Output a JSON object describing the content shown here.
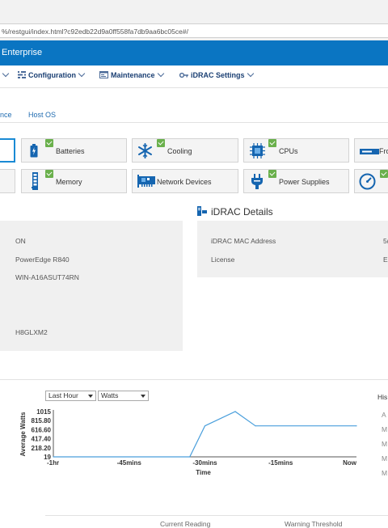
{
  "browser": {
    "url": "%/restgui/index.html?c92edb22d9a0ff558fa7db9aa6bc05ce#/"
  },
  "header": {
    "title": "Enterprise"
  },
  "nav": {
    "configuration": "Configuration",
    "maintenance": "Maintenance",
    "idrac_settings": "iDRAC Settings"
  },
  "subtabs": {
    "first": "nce",
    "second": "Host OS"
  },
  "tiles": [
    {
      "label": "",
      "icon": "blank"
    },
    {
      "label": "Batteries",
      "icon": "battery-icon"
    },
    {
      "label": "Cooling",
      "icon": "snowflake-icon"
    },
    {
      "label": "CPUs",
      "icon": "cpu-icon"
    },
    {
      "label": "Fro",
      "icon": "front-panel-icon"
    },
    {
      "label": "",
      "icon": "blank"
    },
    {
      "label": "Memory",
      "icon": "memory-icon"
    },
    {
      "label": "Network Devices",
      "icon": "network-card-icon"
    },
    {
      "label": "Power Supplies",
      "icon": "power-plug-icon"
    },
    {
      "label": "",
      "icon": "gauge-icon"
    }
  ],
  "system_info": {
    "values": [
      "ON",
      "PowerEdge R840",
      "WIN-A16ASUT74RN",
      "H8GLXM2"
    ]
  },
  "idrac_details": {
    "title": "iDRAC Details",
    "rows": [
      {
        "label": "iDRAC MAC Address",
        "value": "5("
      },
      {
        "label": "License",
        "value": "Er"
      }
    ]
  },
  "power_chart": {
    "range_select": "Last Hour",
    "unit_select": "Watts",
    "history_label": "His",
    "history_items": [
      "A",
      "M",
      "M",
      "M",
      "M"
    ]
  },
  "chart_data": {
    "type": "line",
    "xlabel": "Time",
    "ylabel": "Average Watts",
    "x_ticks": [
      "-1hr",
      "-45mins",
      "-30mins",
      "-15mins",
      "Now"
    ],
    "y_ticks": [
      "1015",
      "815.80",
      "616.60",
      "417.40",
      "218.20",
      "19"
    ],
    "ylim": [
      19,
      1015
    ],
    "x_minutes": [
      -60,
      -33,
      -30,
      -24,
      -20,
      0
    ],
    "values": [
      19,
      19,
      700,
      1015,
      700,
      700
    ],
    "line_color": "#4a9fdc"
  },
  "footer": {
    "col1": "Current Reading",
    "col2": "Warning Threshold"
  }
}
